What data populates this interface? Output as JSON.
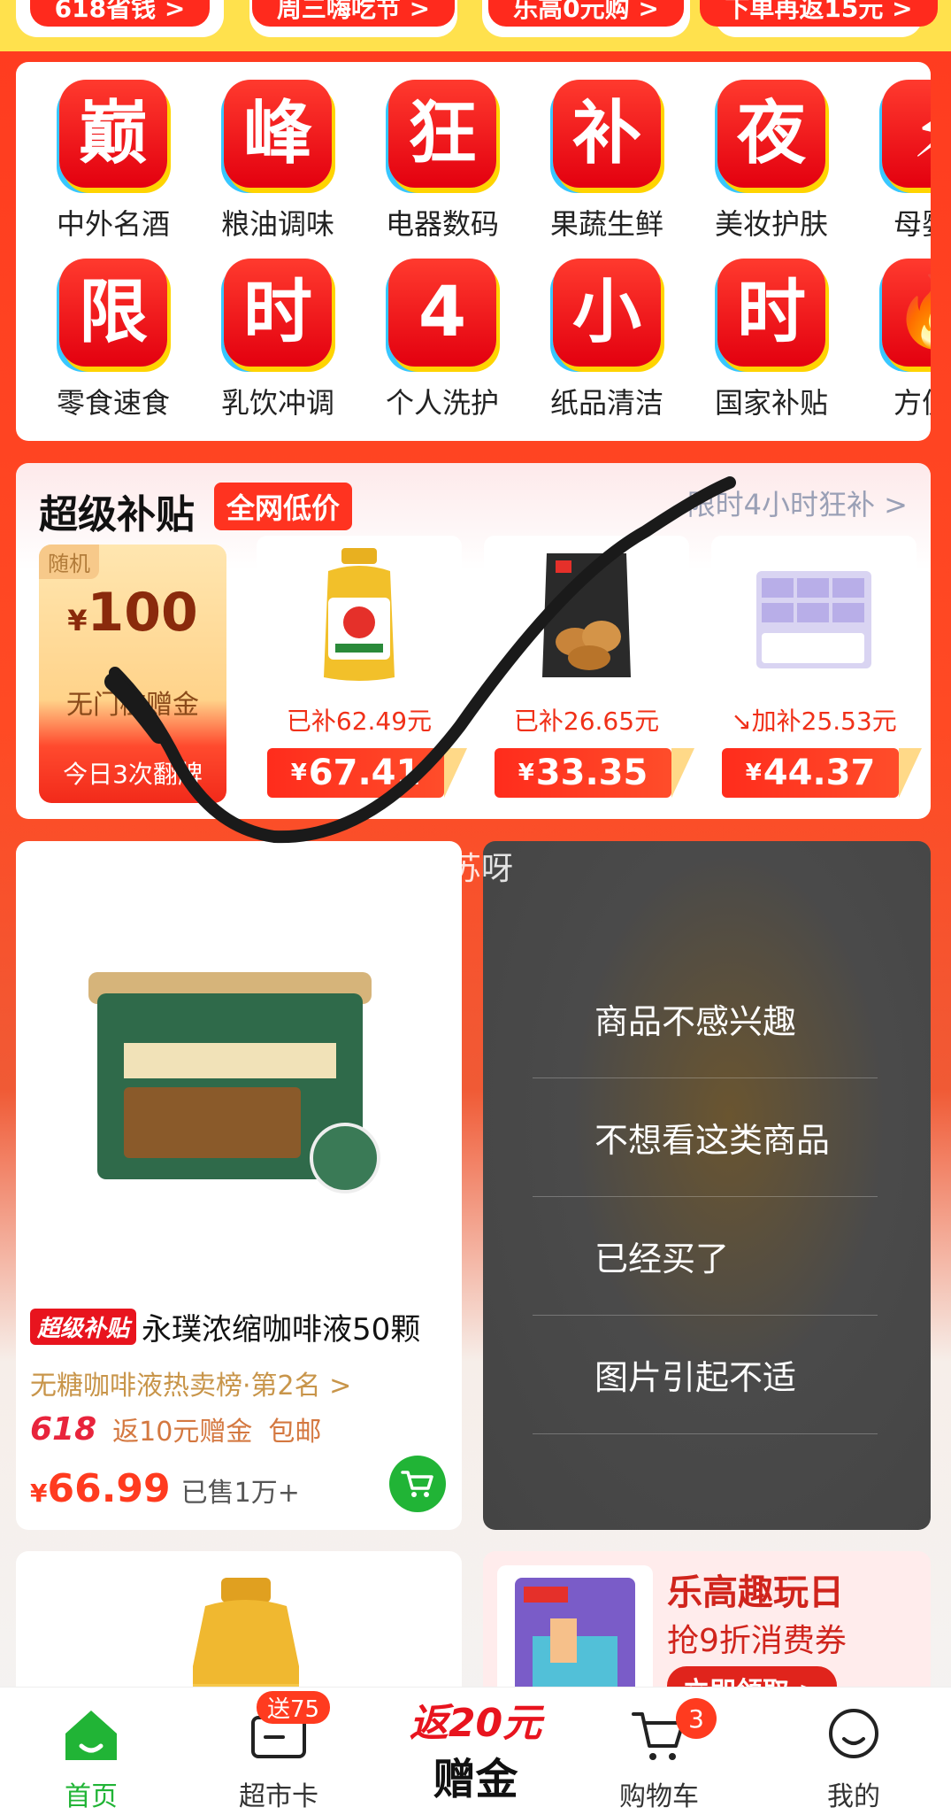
{
  "top_strip": {
    "pills": [
      "618省钱 >",
      "周三嗨吃节 >",
      "乐高0元购 >",
      "下单再返15元 >"
    ]
  },
  "categories": {
    "row1": [
      {
        "glyph": "巅",
        "label": "中外名酒"
      },
      {
        "glyph": "峰",
        "label": "粮油调味"
      },
      {
        "glyph": "狂",
        "label": "电器数码"
      },
      {
        "glyph": "补",
        "label": "果蔬生鲜"
      },
      {
        "glyph": "夜",
        "label": "美妆护肤"
      },
      {
        "glyph": "⚡",
        "label": "母婴育"
      }
    ],
    "row2": [
      {
        "glyph": "限",
        "label": "零食速食"
      },
      {
        "glyph": "时",
        "label": "乳饮冲调"
      },
      {
        "glyph": "4",
        "label": "个人洗护"
      },
      {
        "glyph": "小",
        "label": "纸品清洁"
      },
      {
        "glyph": "时",
        "label": "国家补贴"
      },
      {
        "glyph": "🔥",
        "label": "方便食"
      }
    ]
  },
  "subsidy": {
    "title": "超级补贴",
    "badge": "全网低价",
    "more": "限时4小时狂补 >",
    "bonus": {
      "tag": "随机",
      "yen": "¥",
      "amount": "100",
      "desc": "无门槛赠金",
      "foot": "今日3次翻牌"
    },
    "products": [
      {
        "subsidy": "已补62.49元",
        "yen": "¥",
        "price": "67.41"
      },
      {
        "subsidy": "已补26.65元",
        "yen": "¥",
        "price": "33.35"
      },
      {
        "subsidy": "↘加补25.53元",
        "yen": "¥",
        "price": "44.37"
      }
    ]
  },
  "feed": {
    "left": {
      "badge": "超级补贴",
      "title": "永璞浓缩咖啡液50颗",
      "rank": "无糖咖啡液热卖榜·第2名 >",
      "promo_618": "618",
      "promo_gift": "返10元赠金",
      "promo_ship": "包邮",
      "yen": "¥",
      "price": "66.99",
      "sold": "已售1万+"
    },
    "feedback_options": [
      "商品不感兴趣",
      "不想看这类商品",
      "已经买了",
      "图片引起不适"
    ],
    "lego": {
      "title": "乐高趣玩日",
      "subtitle": "抢9折消费券",
      "button": "立即领取 >"
    }
  },
  "watermark": "我是苏苏呀",
  "tabbar": {
    "home": "首页",
    "card": "超市卡",
    "card_badge": "送75",
    "center_line1": "返20元",
    "center_line2": "赠金",
    "cart": "购物车",
    "cart_badge": "3",
    "me": "我的"
  },
  "colors": {
    "accent_red": "#ff3b1f",
    "green": "#21b436",
    "yellow": "#ffe14d"
  }
}
